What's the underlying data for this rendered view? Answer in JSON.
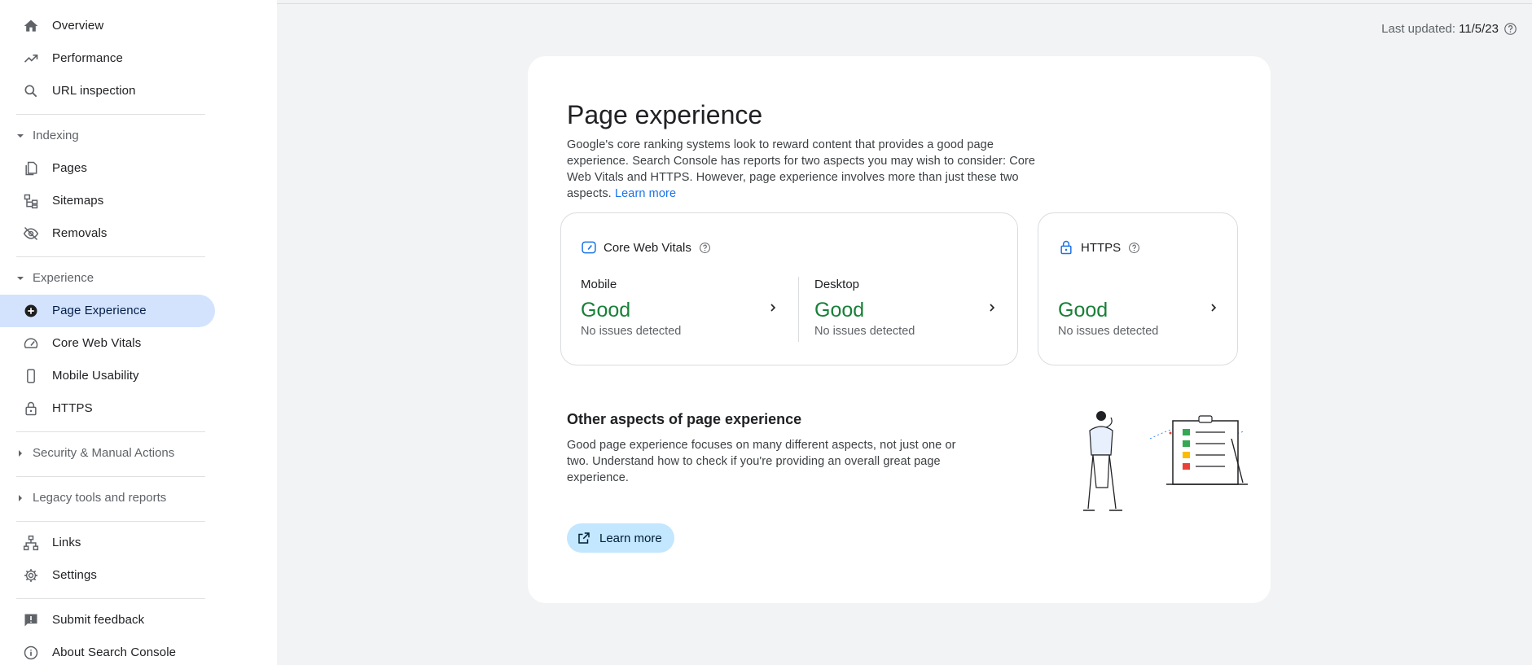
{
  "sidebar": {
    "top_items": [
      {
        "label": "Overview",
        "icon": "home-icon"
      },
      {
        "label": "Performance",
        "icon": "trending-up-icon"
      },
      {
        "label": "URL inspection",
        "icon": "search-icon"
      }
    ],
    "sections": [
      {
        "title": "Indexing",
        "expanded": true,
        "items": [
          {
            "label": "Pages",
            "icon": "pages-icon"
          },
          {
            "label": "Sitemaps",
            "icon": "sitemap-icon"
          },
          {
            "label": "Removals",
            "icon": "visibility-off-icon"
          }
        ]
      },
      {
        "title": "Experience",
        "expanded": true,
        "items": [
          {
            "label": "Page Experience",
            "icon": "add-circle-icon",
            "active": true
          },
          {
            "label": "Core Web Vitals",
            "icon": "speed-icon"
          },
          {
            "label": "Mobile Usability",
            "icon": "smartphone-icon"
          },
          {
            "label": "HTTPS",
            "icon": "lock-icon"
          }
        ]
      },
      {
        "title": "Security & Manual Actions",
        "expanded": false
      },
      {
        "title": "Legacy tools and reports",
        "expanded": false
      }
    ],
    "bottom_items": [
      {
        "label": "Links",
        "icon": "links-icon"
      },
      {
        "label": "Settings",
        "icon": "gear-icon"
      }
    ],
    "footer_items": [
      {
        "label": "Submit feedback",
        "icon": "feedback-icon"
      },
      {
        "label": "About Search Console",
        "icon": "info-icon"
      }
    ]
  },
  "header": {
    "last_updated_label": "Last updated:",
    "last_updated_date": "11/5/23"
  },
  "main": {
    "title": "Page experience",
    "intro_text": "Google's core ranking systems look to reward content that provides a good page experience. Search Console has reports for two aspects you may wish to consider: Core Web Vitals and HTTPS. However, page experience involves more than just these two aspects.",
    "intro_link": "Learn more",
    "cwv_card": {
      "title": "Core Web Vitals",
      "mobile": {
        "device": "Mobile",
        "status": "Good",
        "detail": "No issues detected"
      },
      "desktop": {
        "device": "Desktop",
        "status": "Good",
        "detail": "No issues detected"
      }
    },
    "https_card": {
      "title": "HTTPS",
      "status": "Good",
      "detail": "No issues detected"
    },
    "other": {
      "title": "Other aspects of page experience",
      "body": "Good page experience focuses on many different aspects, not just one or two. Understand how to check if you're providing an overall great page experience.",
      "button_label": "Learn more"
    }
  },
  "colors": {
    "good_green": "#188038",
    "active_nav_bg": "#d3e3fd",
    "link_blue": "#1a73e8",
    "button_bg": "#c2e7ff"
  }
}
